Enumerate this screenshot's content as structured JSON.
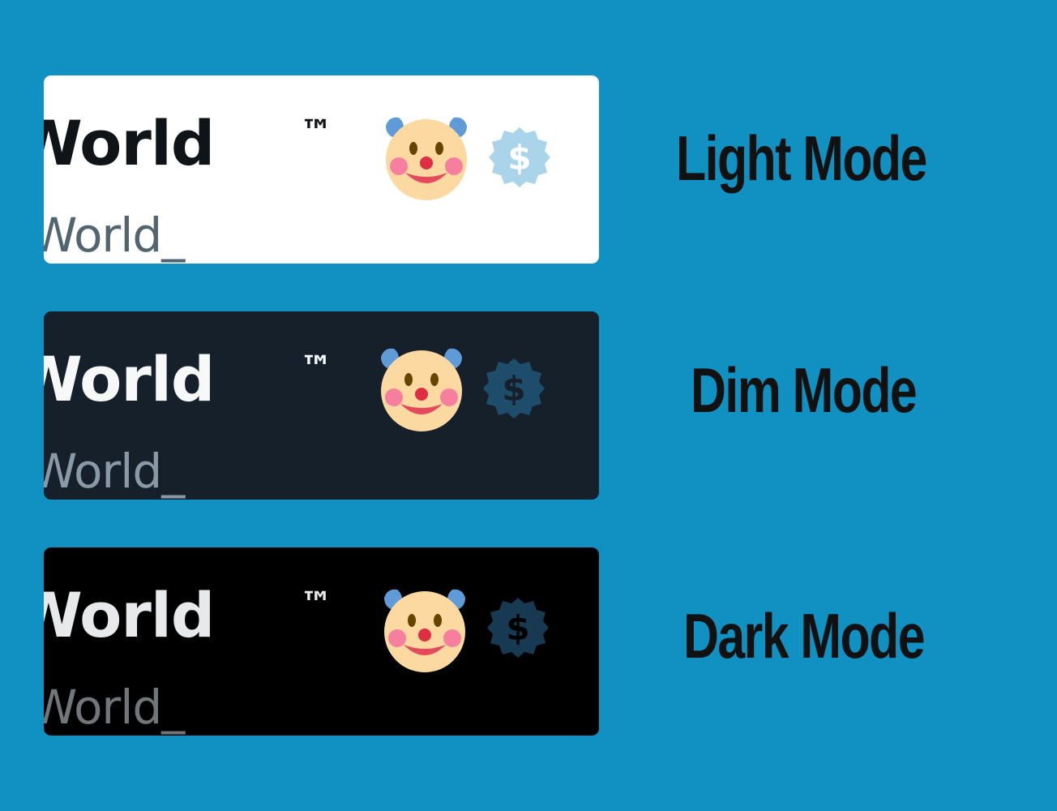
{
  "background_color": "#1190c2",
  "cards": [
    {
      "mode": "light",
      "display_name": "World",
      "trademark": "™",
      "handle": "World_",
      "emoji_icon": "clown-face-icon",
      "badge_icon": "verified-dollar-badge-icon",
      "background": "#ffffff",
      "label": "Light Mode"
    },
    {
      "mode": "dim",
      "display_name": "World",
      "trademark": "™",
      "handle": "World_",
      "emoji_icon": "clown-face-icon",
      "badge_icon": "verified-dollar-badge-icon",
      "background": "#16202b",
      "label": "Dim Mode"
    },
    {
      "mode": "dark",
      "display_name": "World",
      "trademark": "™",
      "handle": "World_",
      "emoji_icon": "clown-face-icon",
      "badge_icon": "verified-dollar-badge-icon",
      "background": "#000000",
      "label": "Dark Mode"
    }
  ]
}
